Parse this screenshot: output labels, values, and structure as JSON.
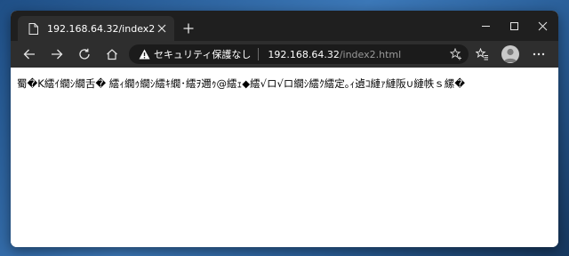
{
  "tab": {
    "title": "192.168.64.32/index2.html"
  },
  "address_bar": {
    "security_label": "セキュリティ保護なし",
    "url_host": "192.168.64.32",
    "url_path": "/index2.html"
  },
  "page": {
    "body_text": "蜀�K繧ｲ繝ｼ繝舌� 繧ｨ繝ｩ繝ｼ繧ｷ繝･繧ｦ邇ｩ@繧ｪ◆繧√ロ√ロ繝ｼ繧ｸ繧定｡ｨ遉ｺ縺ｧ縺阪∪縺帙ｓ縲�"
  },
  "colors": {
    "titlebar": "#1f1f1f",
    "toolbar": "#2e2e2e",
    "address_bar": "#1b1b1b",
    "page_background": "#ffffff"
  }
}
